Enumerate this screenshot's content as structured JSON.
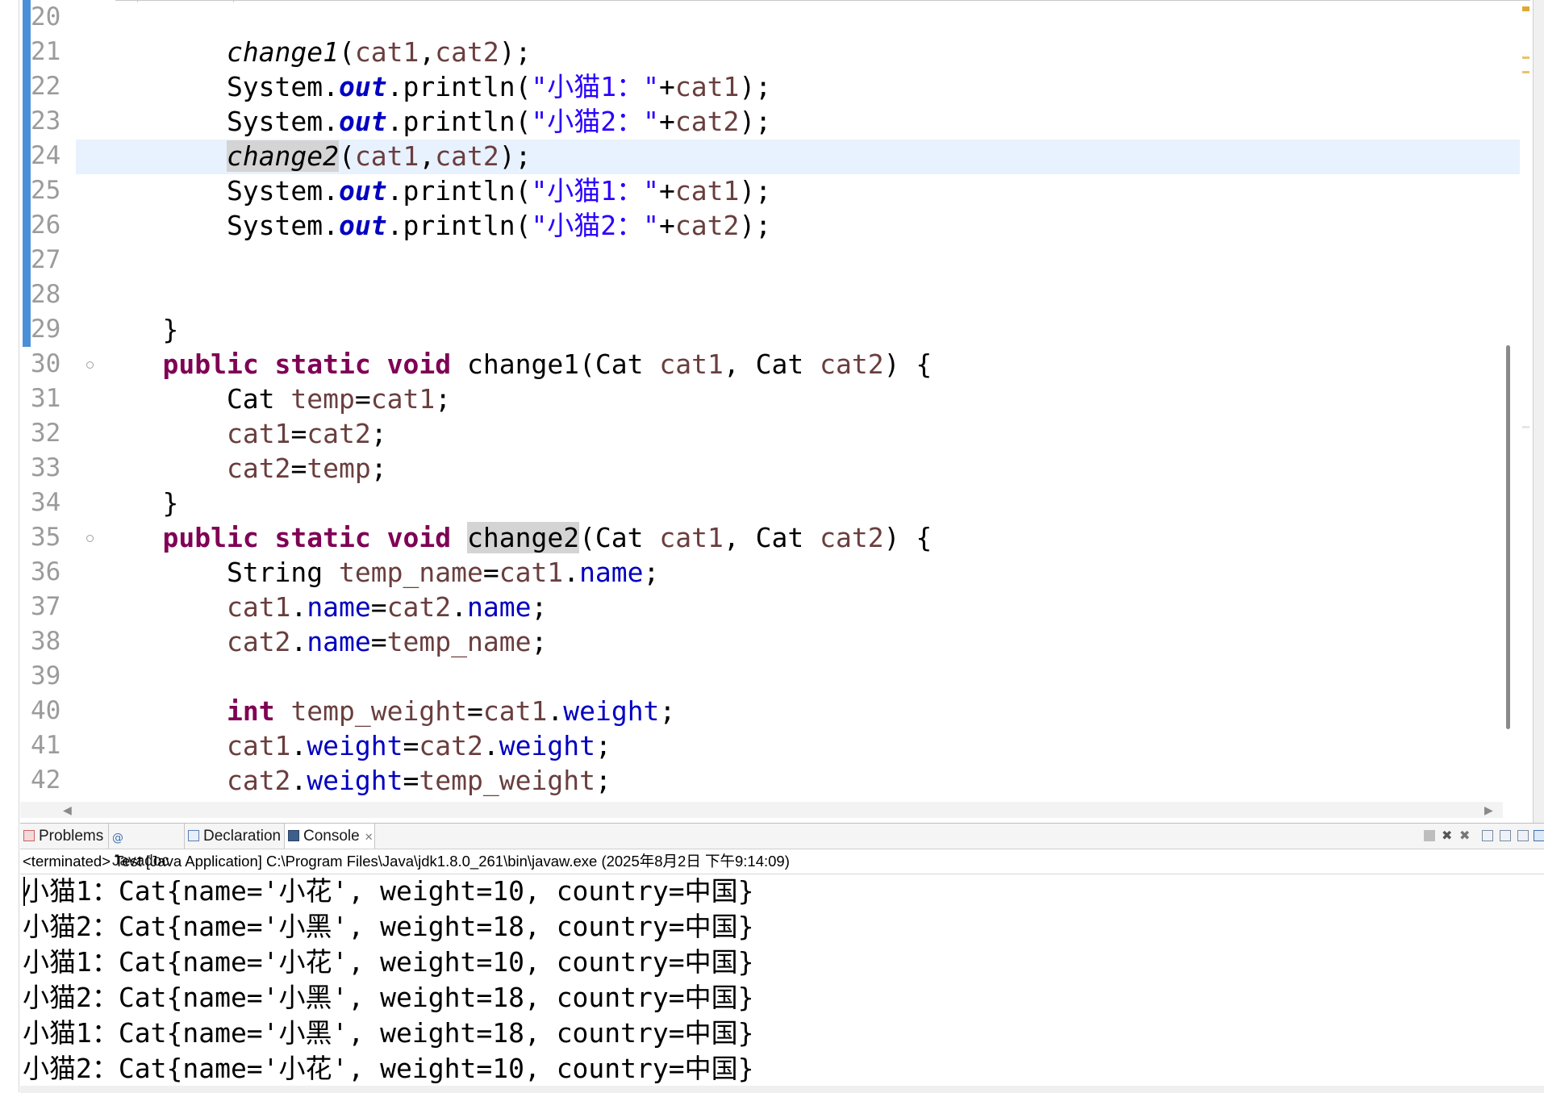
{
  "editor": {
    "lines": [
      {
        "num": "20",
        "tokens": []
      },
      {
        "num": "21",
        "tokens": [
          [
            "        ",
            ""
          ],
          [
            "change1",
            "meth-it"
          ],
          [
            "(",
            ""
          ],
          [
            "cat1",
            "var"
          ],
          [
            ",",
            ""
          ],
          [
            "cat2",
            "var"
          ],
          [
            ");",
            ""
          ]
        ]
      },
      {
        "num": "22",
        "tokens": [
          [
            "        System.",
            ""
          ],
          [
            "out",
            "sfld"
          ],
          [
            ".println(",
            ""
          ],
          [
            "\"小猫1：\"",
            "str"
          ],
          [
            "+",
            ""
          ],
          [
            "cat1",
            "var"
          ],
          [
            ");",
            ""
          ]
        ]
      },
      {
        "num": "23",
        "tokens": [
          [
            "        System.",
            ""
          ],
          [
            "out",
            "sfld"
          ],
          [
            ".println(",
            ""
          ],
          [
            "\"小猫2：\"",
            "str"
          ],
          [
            "+",
            ""
          ],
          [
            "cat2",
            "var"
          ],
          [
            ");",
            ""
          ]
        ]
      },
      {
        "num": "24",
        "tokens": [
          [
            "        ",
            ""
          ],
          [
            "change2",
            "meth-it occ"
          ],
          [
            "(",
            ""
          ],
          [
            "cat1",
            "var"
          ],
          [
            ",",
            ""
          ],
          [
            "cat2",
            "var"
          ],
          [
            ");",
            ""
          ]
        ]
      },
      {
        "num": "25",
        "tokens": [
          [
            "        System.",
            ""
          ],
          [
            "out",
            "sfld"
          ],
          [
            ".println(",
            ""
          ],
          [
            "\"小猫1：\"",
            "str"
          ],
          [
            "+",
            ""
          ],
          [
            "cat1",
            "var"
          ],
          [
            ");",
            ""
          ]
        ]
      },
      {
        "num": "26",
        "tokens": [
          [
            "        System.",
            ""
          ],
          [
            "out",
            "sfld"
          ],
          [
            ".println(",
            ""
          ],
          [
            "\"小猫2：\"",
            "str"
          ],
          [
            "+",
            ""
          ],
          [
            "cat2",
            "var"
          ],
          [
            ");",
            ""
          ]
        ]
      },
      {
        "num": "27",
        "tokens": []
      },
      {
        "num": "28",
        "tokens": []
      },
      {
        "num": "29",
        "tokens": [
          [
            "    }",
            ""
          ]
        ]
      },
      {
        "num": "30",
        "fold": true,
        "tokens": [
          [
            "    ",
            ""
          ],
          [
            "public static void",
            "kw"
          ],
          [
            " change1(Cat ",
            ""
          ],
          [
            "cat1",
            "var"
          ],
          [
            ", Cat ",
            ""
          ],
          [
            "cat2",
            "var"
          ],
          [
            ") {",
            ""
          ]
        ]
      },
      {
        "num": "31",
        "tokens": [
          [
            "        Cat ",
            ""
          ],
          [
            "temp",
            "var"
          ],
          [
            "=",
            ""
          ],
          [
            "cat1",
            "var"
          ],
          [
            ";",
            ""
          ]
        ]
      },
      {
        "num": "32",
        "tokens": [
          [
            "        ",
            ""
          ],
          [
            "cat1",
            "var"
          ],
          [
            "=",
            ""
          ],
          [
            "cat2",
            "var"
          ],
          [
            ";",
            ""
          ]
        ]
      },
      {
        "num": "33",
        "tokens": [
          [
            "        ",
            ""
          ],
          [
            "cat2",
            "var"
          ],
          [
            "=",
            ""
          ],
          [
            "temp",
            "var"
          ],
          [
            ";",
            ""
          ]
        ]
      },
      {
        "num": "34",
        "tokens": [
          [
            "    }",
            ""
          ]
        ]
      },
      {
        "num": "35",
        "fold": true,
        "tokens": [
          [
            "    ",
            ""
          ],
          [
            "public static void",
            "kw"
          ],
          [
            " ",
            ""
          ],
          [
            "change2",
            "occ"
          ],
          [
            "(Cat ",
            ""
          ],
          [
            "cat1",
            "var"
          ],
          [
            ", Cat ",
            ""
          ],
          [
            "cat2",
            "var"
          ],
          [
            ") {",
            ""
          ]
        ]
      },
      {
        "num": "36",
        "tokens": [
          [
            "        String ",
            ""
          ],
          [
            "temp_name",
            "var"
          ],
          [
            "=",
            ""
          ],
          [
            "cat1",
            "var"
          ],
          [
            ".",
            ""
          ],
          [
            "name",
            "fld"
          ],
          [
            ";",
            ""
          ]
        ]
      },
      {
        "num": "37",
        "tokens": [
          [
            "        ",
            ""
          ],
          [
            "cat1",
            "var"
          ],
          [
            ".",
            ""
          ],
          [
            "name",
            "fld"
          ],
          [
            "=",
            ""
          ],
          [
            "cat2",
            "var"
          ],
          [
            ".",
            ""
          ],
          [
            "name",
            "fld"
          ],
          [
            ";",
            ""
          ]
        ]
      },
      {
        "num": "38",
        "tokens": [
          [
            "        ",
            ""
          ],
          [
            "cat2",
            "var"
          ],
          [
            ".",
            ""
          ],
          [
            "name",
            "fld"
          ],
          [
            "=",
            ""
          ],
          [
            "temp_name",
            "var"
          ],
          [
            ";",
            ""
          ]
        ]
      },
      {
        "num": "39",
        "tokens": []
      },
      {
        "num": "40",
        "tokens": [
          [
            "        ",
            ""
          ],
          [
            "int",
            "kw"
          ],
          [
            " ",
            ""
          ],
          [
            "temp_weight",
            "var"
          ],
          [
            "=",
            ""
          ],
          [
            "cat1",
            "var"
          ],
          [
            ".",
            ""
          ],
          [
            "weight",
            "fld"
          ],
          [
            ";",
            ""
          ]
        ]
      },
      {
        "num": "41",
        "tokens": [
          [
            "        ",
            ""
          ],
          [
            "cat1",
            "var"
          ],
          [
            ".",
            ""
          ],
          [
            "weight",
            "fld"
          ],
          [
            "=",
            ""
          ],
          [
            "cat2",
            "var"
          ],
          [
            ".",
            ""
          ],
          [
            "weight",
            "fld"
          ],
          [
            ";",
            ""
          ]
        ]
      },
      {
        "num": "42",
        "tokens": [
          [
            "        ",
            ""
          ],
          [
            "cat2",
            "var"
          ],
          [
            ".",
            ""
          ],
          [
            "weight",
            "fld"
          ],
          [
            "=",
            ""
          ],
          [
            "temp_weight",
            "var"
          ],
          [
            ";",
            ""
          ]
        ]
      }
    ],
    "current_line": "24"
  },
  "panel": {
    "tabs": [
      {
        "label": "Problems",
        "icon": "problems-icon"
      },
      {
        "label": "Javadoc",
        "icon": "javadoc-icon"
      },
      {
        "label": "Declaration",
        "icon": "declaration-icon"
      },
      {
        "label": "Console",
        "icon": "console-icon",
        "active": true,
        "closable": true
      }
    ],
    "toolbar_icons": [
      "terminate-icon",
      "remove-launch-icon",
      "remove-all-terminated-icon",
      "scroll-lock-icon",
      "word-wrap-icon",
      "pin-console-icon",
      "display-console-icon"
    ],
    "console_header": "<terminated> Test [Java Application] C:\\Program Files\\Java\\jdk1.8.0_261\\bin\\javaw.exe (2025年8月2日 下午9:14:09)",
    "output": [
      "小猫1：Cat{name='小花', weight=10, country=中国}",
      "小猫2：Cat{name='小黑', weight=18, country=中国}",
      "小猫1：Cat{name='小花', weight=10, country=中国}",
      "小猫2：Cat{name='小黑', weight=18, country=中国}",
      "小猫1：Cat{name='小黑', weight=18, country=中国}",
      "小猫2：Cat{name='小花', weight=10, country=中国}"
    ]
  },
  "colors": {
    "keyword": "#7f0055",
    "field": "#0000c0",
    "local_variable": "#6a3e3e",
    "string": "#2a00ff",
    "current_line_bg": "#e8f2fe",
    "change_bar": "#4a90d9"
  }
}
